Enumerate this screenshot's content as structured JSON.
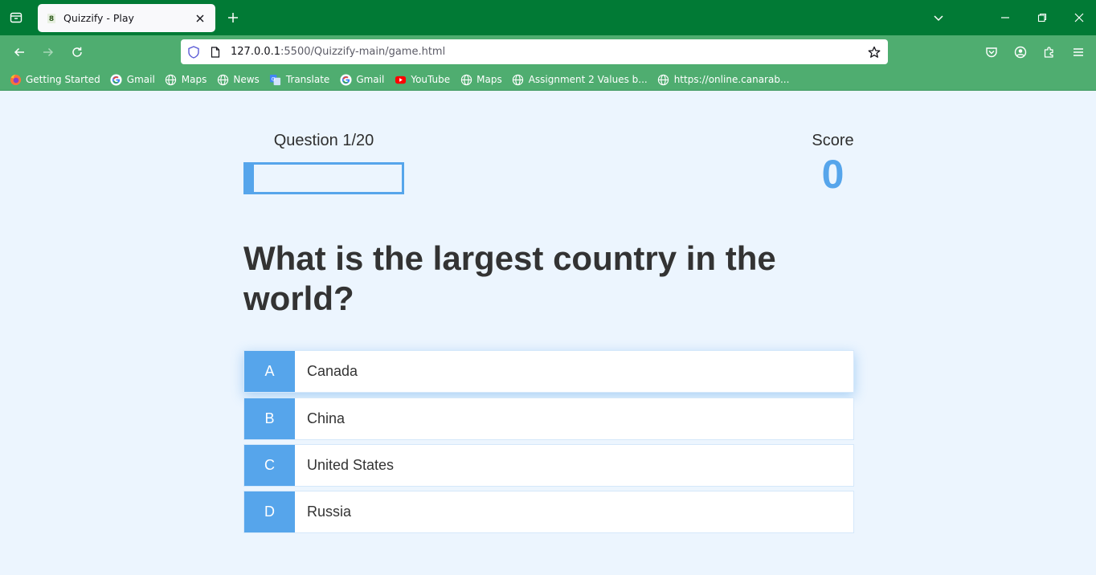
{
  "browser": {
    "tab_title": "Quizzify - Play",
    "url_host": "127.0.0.1",
    "url_rest": ":5500/Quizzify-main/game.html",
    "theme_color": "#017a35",
    "toolbar_color": "#4fad70"
  },
  "bookmarks": [
    {
      "label": "Getting Started",
      "icon": "firefox-icon"
    },
    {
      "label": "Gmail",
      "icon": "google-icon"
    },
    {
      "label": "Maps",
      "icon": "globe-icon"
    },
    {
      "label": "News",
      "icon": "globe-icon"
    },
    {
      "label": "Translate",
      "icon": "translate-icon"
    },
    {
      "label": "Gmail",
      "icon": "google-icon"
    },
    {
      "label": "YouTube",
      "icon": "youtube-icon"
    },
    {
      "label": "Maps",
      "icon": "globe-icon"
    },
    {
      "label": "Assignment 2 Values b...",
      "icon": "globe-icon"
    },
    {
      "label": "https://online.canarab...",
      "icon": "globe-icon"
    }
  ],
  "hud": {
    "question_label": "Question 1/20",
    "progress_fraction": 0.05,
    "score_label": "Score",
    "score_value": "0",
    "accent_color": "#56a5eb"
  },
  "question": "What is the largest country in the world?",
  "choices": [
    {
      "prefix": "A",
      "text": "Canada"
    },
    {
      "prefix": "B",
      "text": "China"
    },
    {
      "prefix": "C",
      "text": "United States"
    },
    {
      "prefix": "D",
      "text": "Russia"
    }
  ]
}
